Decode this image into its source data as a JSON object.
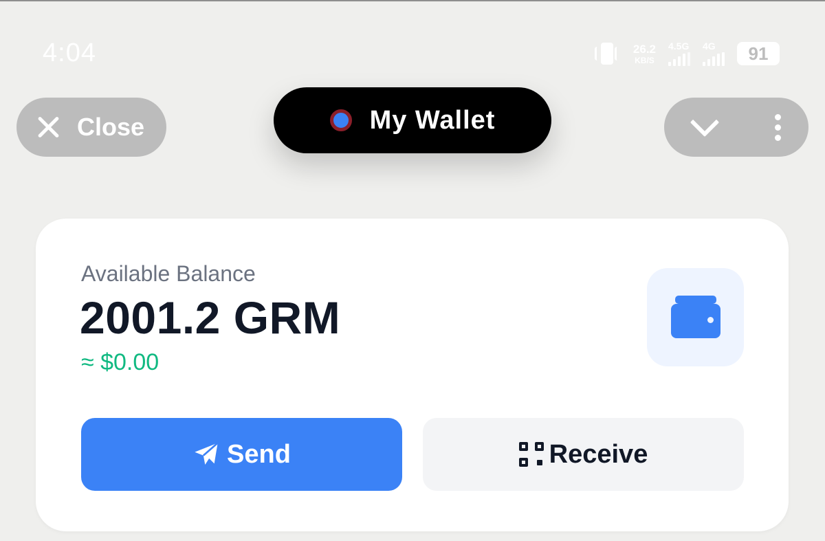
{
  "status_bar": {
    "time": "4:04",
    "net_speed_value": "26.2",
    "net_speed_unit": "KB/S",
    "signal1_label": "4.5G",
    "signal2_label": "4G",
    "battery": "91"
  },
  "header": {
    "close_label": "Close",
    "title": "My Wallet"
  },
  "balance_card": {
    "label": "Available Balance",
    "amount": "2001.2 GRM",
    "fiat": "≈ $0.00",
    "send_label": "Send",
    "receive_label": "Receive"
  },
  "colors": {
    "accent": "#3b82f6",
    "positive": "#10b981",
    "pill_gray": "#bcbcbc"
  },
  "icons": {
    "close": "close-icon",
    "chevron": "chevron-down-icon",
    "more": "more-vertical-icon",
    "wallet": "wallet-icon",
    "send": "paper-plane-icon",
    "receive": "qr-code-icon"
  }
}
